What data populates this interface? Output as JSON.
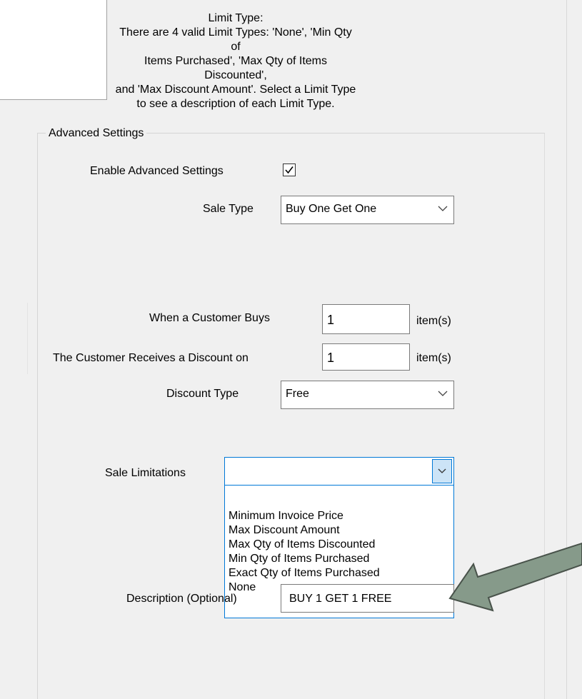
{
  "limit_type": {
    "title": "Limit Type:",
    "line1": "There are 4 valid Limit Types: 'None', 'Min Qty of",
    "line2": "Items Purchased', 'Max Qty of Items Discounted',",
    "line3": "and 'Max Discount Amount'. Select a Limit Type",
    "line4": "to see a description of each Limit Type."
  },
  "advanced": {
    "group_title": "Advanced Settings",
    "enable_label": "Enable Advanced Settings",
    "enable_checked": true,
    "sale_type_label": "Sale Type",
    "sale_type_value": "Buy One Get One",
    "customer_buys_label": "When a Customer Buys",
    "customer_buys_value": "1",
    "customer_buys_unit": "item(s)",
    "receives_label": "The Customer Receives a Discount on",
    "receives_value": "1",
    "receives_unit": "item(s)",
    "discount_type_label": "Discount Type",
    "discount_type_value": "Free",
    "sale_limitations_label": "Sale Limitations",
    "sale_limitations_value": "",
    "sale_limitations_options": [
      "Minimum Invoice Price",
      "Max Discount Amount",
      "Max Qty of Items Discounted",
      "Min Qty of Items Purchased",
      "Exact Qty of Items Purchased",
      "None"
    ],
    "description_label": "Description (Optional)",
    "description_value": "BUY 1 GET 1 FREE"
  },
  "colors": {
    "window_bg": "#f0f0f0",
    "focus_border": "#0078d7",
    "annotation_arrow": "#869a8a"
  }
}
